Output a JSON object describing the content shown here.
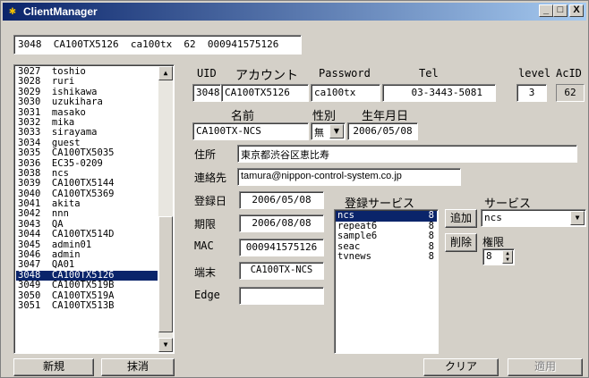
{
  "window": {
    "title": "ClientManager",
    "buttons": {
      "minimize": "_",
      "maximize": "□",
      "close": "X"
    }
  },
  "summary_line": "3048  CA100TX5126  ca100tx  62  000941575126",
  "clients": [
    {
      "text": "3027  toshio"
    },
    {
      "text": "3028  ruri"
    },
    {
      "text": "3029  ishikawa"
    },
    {
      "text": "3030  uzukihara"
    },
    {
      "text": "3031  masako"
    },
    {
      "text": "3032  mika"
    },
    {
      "text": "3033  sirayama"
    },
    {
      "text": "3034  guest"
    },
    {
      "text": "3035  CA100TX5035"
    },
    {
      "text": "3036  EC35-0209"
    },
    {
      "text": "3038  ncs"
    },
    {
      "text": "3039  CA100TX5144"
    },
    {
      "text": "3040  CA100TX5369"
    },
    {
      "text": "3041  akita"
    },
    {
      "text": "3042  nnn"
    },
    {
      "text": "3043  QA"
    },
    {
      "text": "3044  CA100TX514D"
    },
    {
      "text": "3045  admin01"
    },
    {
      "text": "3046  admin"
    },
    {
      "text": "3047  QA01"
    },
    {
      "text": "3048  CA100TX5126",
      "selected": true
    },
    {
      "text": "3049  CA100TX519B"
    },
    {
      "text": "3050  CA100TX519A"
    },
    {
      "text": "3051  CA100TX513B"
    }
  ],
  "form": {
    "uid_label": "UID",
    "account_label": "アカウント",
    "password_label": "Password",
    "tel_label": "Tel",
    "level_label": "level",
    "acid_label": "AcID",
    "uid": "3048",
    "account": "CA100TX5126",
    "password": "ca100tx",
    "tel": "03-3443-5081",
    "level": "3",
    "acid": "62",
    "name_label": "名前",
    "gender_label": "性別",
    "birthday_label": "生年月日",
    "name": "CA100TX-NCS",
    "gender": "無",
    "birthday": "2006/05/08",
    "address_label": "住所",
    "address": "東京都渋谷区恵比寿",
    "contact_label": "連絡先",
    "contact": "tamura@nippon-control-system.co.jp",
    "reg_date_label": "登録日",
    "reg_date": "2006/05/08",
    "expiry_label": "期限",
    "expiry": "2006/08/08",
    "mac_label": "MAC",
    "mac": "000941575126",
    "terminal_label": "端末",
    "terminal": "CA100TX-NCS",
    "edge_label": "Edge",
    "edge": ""
  },
  "registered_services": {
    "label": "登録サービス",
    "items": [
      {
        "name": "ncs",
        "value": "8",
        "selected": true
      },
      {
        "name": "repeat6",
        "value": "8"
      },
      {
        "name": "sample6",
        "value": "8"
      },
      {
        "name": "seac",
        "value": "8"
      },
      {
        "name": "tvnews",
        "value": "8"
      }
    ]
  },
  "service": {
    "label": "サービス",
    "selected": "ncs",
    "add_label": "追加",
    "delete_label": "削除",
    "permission_label": "権限",
    "permission": "8"
  },
  "footer": {
    "new_label": "新規",
    "erase_label": "抹消",
    "clear_label": "クリア",
    "apply_label": "適用"
  },
  "icons": {
    "app": "key-icon",
    "scroll_up": "arrow-up-icon",
    "scroll_down": "arrow-down-icon",
    "dropdown": "chevron-down-icon"
  },
  "colors": {
    "titlebar": "#0a246a",
    "selection": "#0a246a",
    "face": "#d4d0c8"
  }
}
